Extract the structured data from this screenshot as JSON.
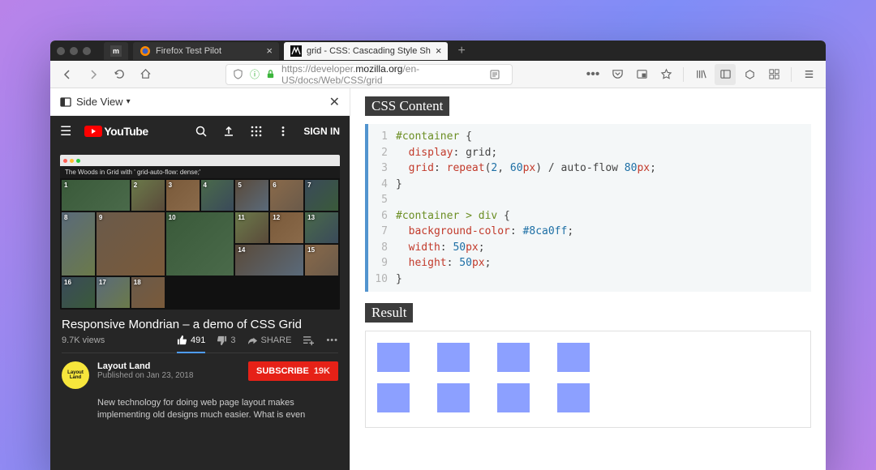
{
  "tabs": {
    "t1": {
      "label": ""
    },
    "t2": {
      "label": "Firefox Test Pilot"
    },
    "t3": {
      "label": "grid - CSS: Cascading Style Sh"
    }
  },
  "url": {
    "prefix": "https://developer.",
    "host": "mozilla.org",
    "path": "/en-US/docs/Web/CSS/grid"
  },
  "sideview": {
    "title": "Side View"
  },
  "youtube": {
    "brand": "YouTube",
    "signin": "SIGN IN",
    "video_inner_title": "The Woods in Grid with ' grid-auto-flow: dense;'",
    "thumb_labels": [
      "1",
      "2",
      "3",
      "4",
      "5",
      "6",
      "7",
      "8",
      "9",
      "10",
      "11",
      "12",
      "13",
      "14",
      "15",
      "16",
      "17",
      "18"
    ],
    "title": "Responsive Mondrian – a demo of CSS Grid",
    "views": "9.7K views",
    "likes": "491",
    "dislikes": "3",
    "share": "SHARE",
    "channel": "Layout Land",
    "channel_logo": "Layout Land",
    "published": "Published on Jan 23, 2018",
    "subscribe": "SUBSCRIBE",
    "sub_count": "19K",
    "description": "New technology for doing web page layout makes implementing old designs much easier. What is even"
  },
  "mdn": {
    "css_heading": "CSS Content",
    "result_heading": "Result",
    "code": {
      "l1_sel": "#container",
      "l1_rest": " {",
      "l2_prop": "display",
      "l2_val": "grid",
      "l3_prop": "grid",
      "l3_func": "repeat",
      "l3_a": "2",
      "l3_b": "60",
      "l3_unit": "px",
      "l3_mid": " / auto-flow ",
      "l3_c": "80",
      "l3_unit2": "px",
      "l6_sel": "#container > div",
      "l6_rest": " {",
      "l7_prop": "background-color",
      "l7_val": "#8ca0ff",
      "l8_prop": "width",
      "l8_num": "50",
      "l8_unit": "px",
      "l9_prop": "height",
      "l9_num": "50",
      "l9_unit": "px"
    }
  }
}
